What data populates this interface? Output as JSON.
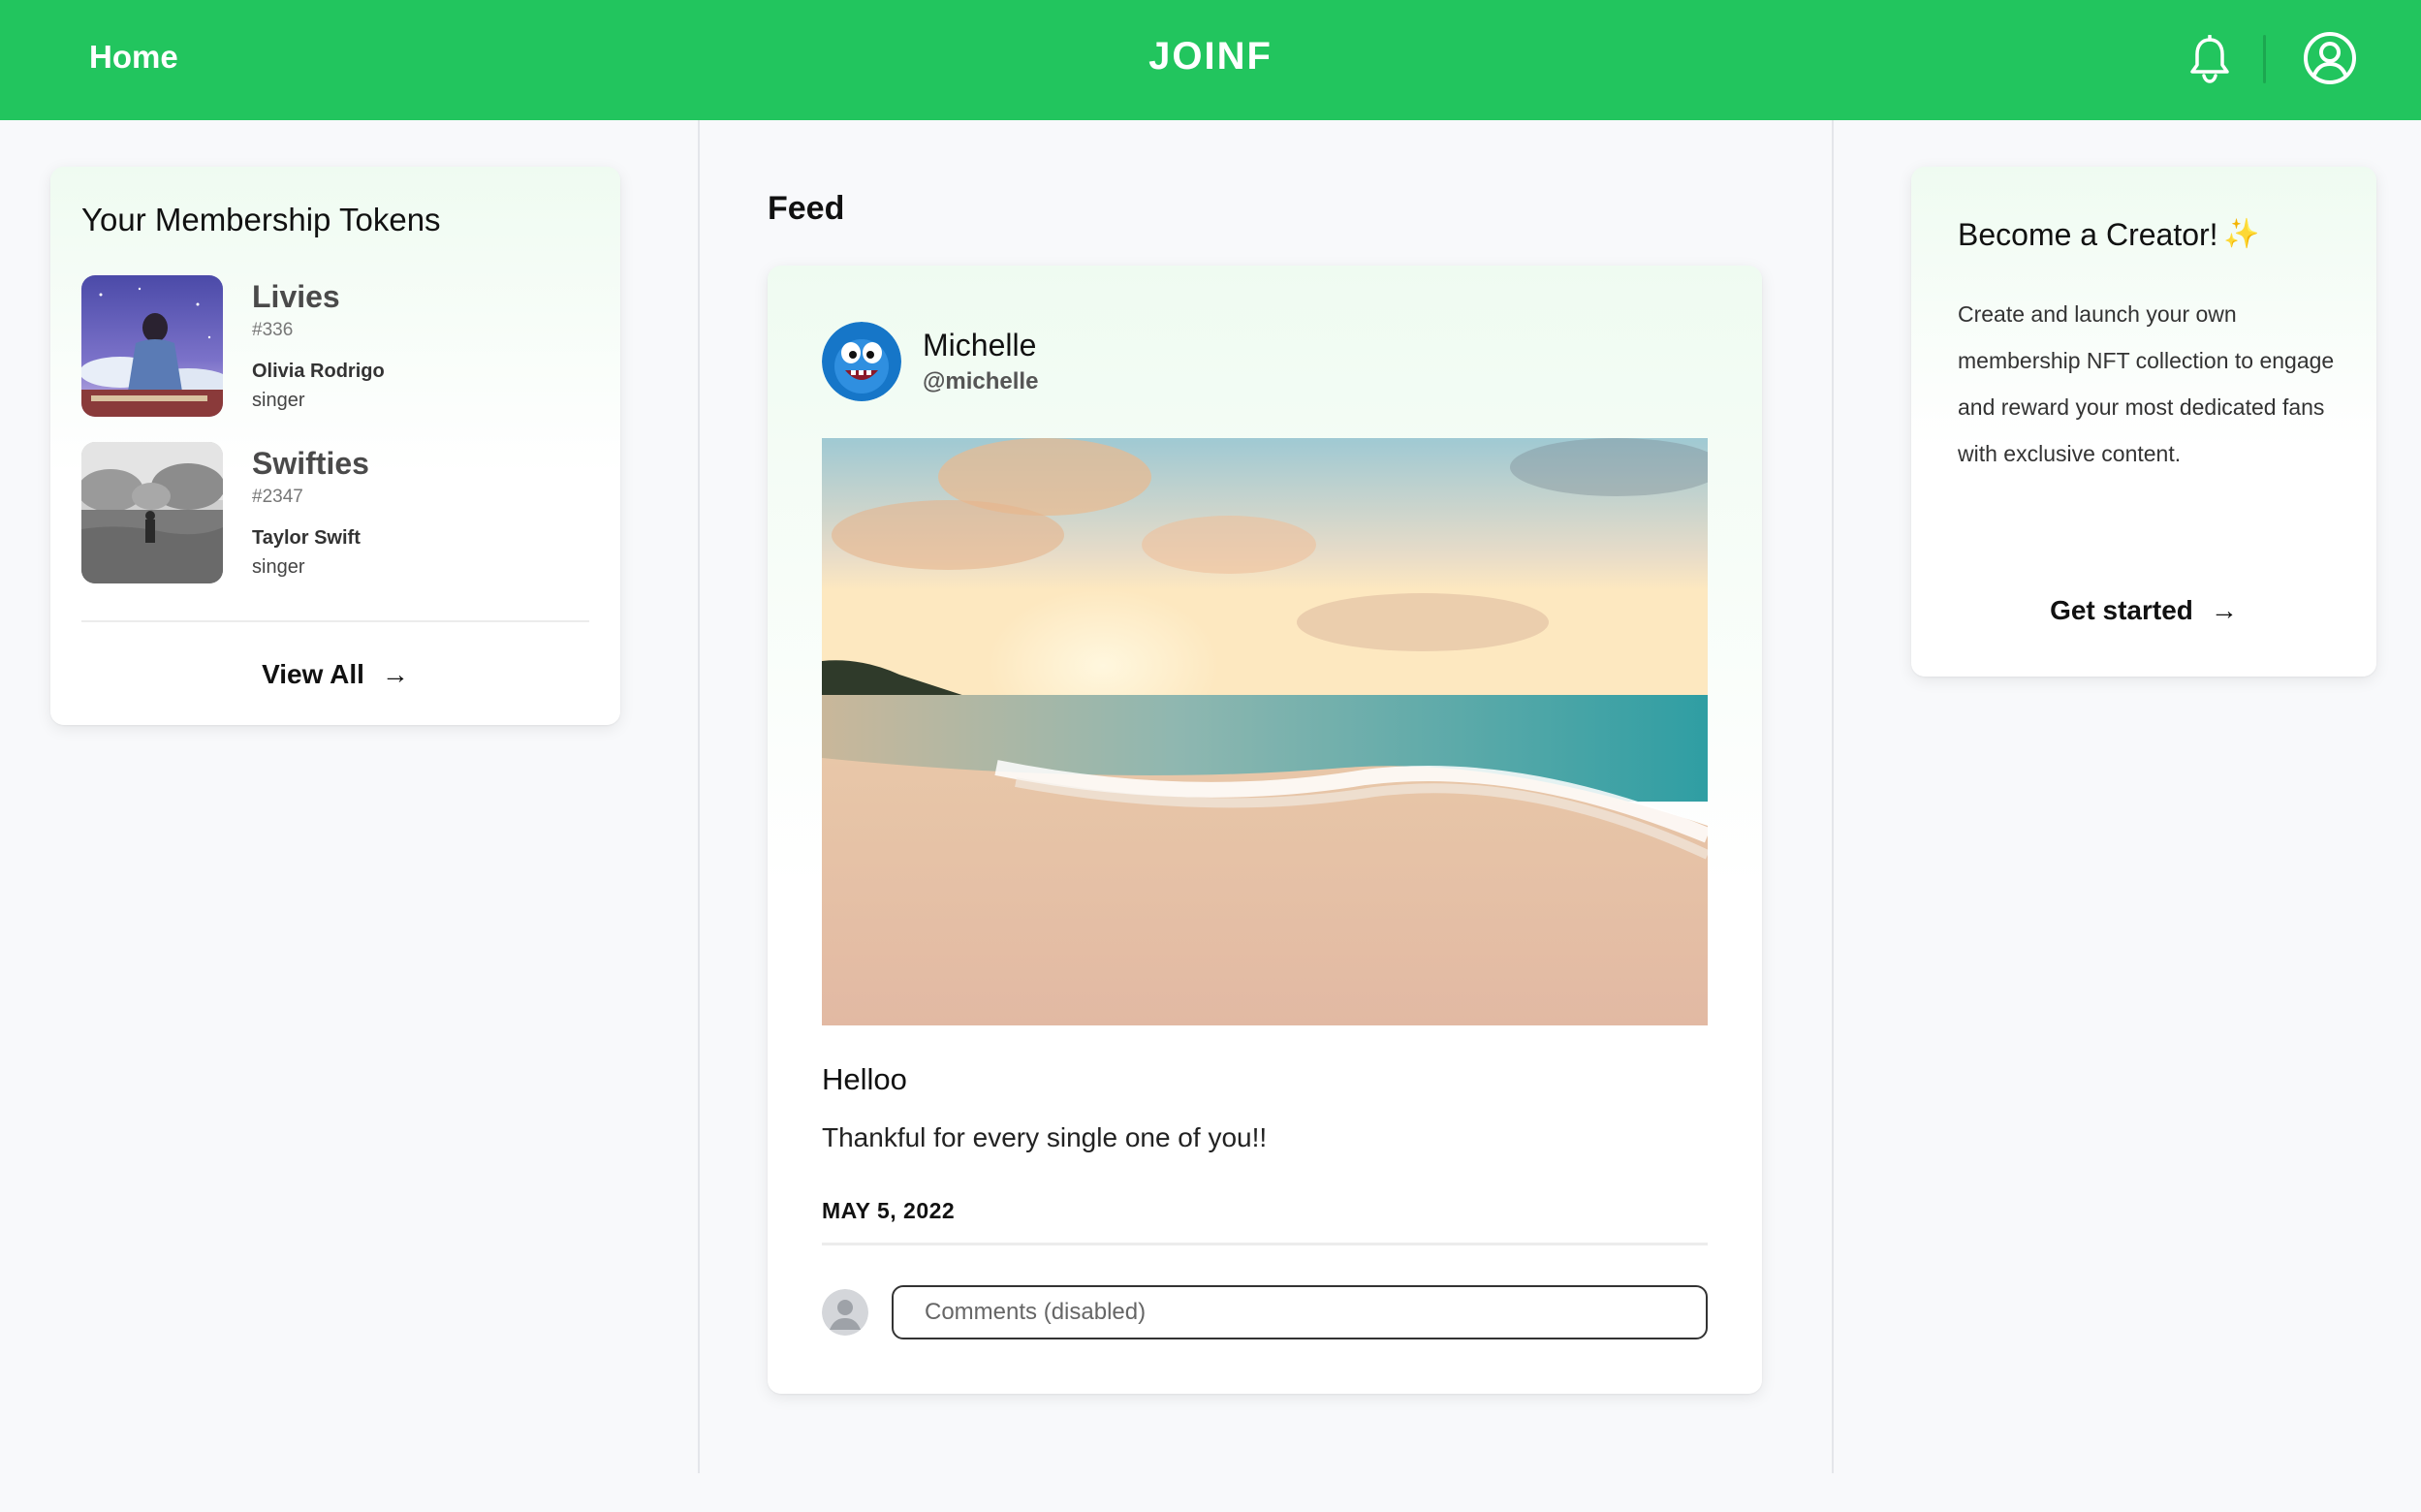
{
  "header": {
    "home_label": "Home",
    "brand": "JOINF",
    "bell_icon": "bell-icon",
    "user_icon": "user-circle-icon",
    "accent_color": "#22c55e"
  },
  "tokens": {
    "title": "Your Membership Tokens",
    "items": [
      {
        "name": "Livies",
        "number": "#336",
        "artist": "Olivia Rodrigo",
        "role": "singer"
      },
      {
        "name": "Swifties",
        "number": "#2347",
        "artist": "Taylor Swift",
        "role": "singer"
      }
    ],
    "view_all_label": "View All",
    "arrow_icon": "arrow-right-icon"
  },
  "feed": {
    "title": "Feed",
    "post": {
      "author": "Michelle",
      "handle": "@michelle",
      "title": "Helloo",
      "body": "Thankful for every single one of you!!",
      "date": "MAY 5, 2022",
      "comment_placeholder": "Comments (disabled)"
    }
  },
  "creator": {
    "title": "Become a Creator!",
    "sparkle": "✨",
    "body": "Create and launch your own membership NFT collection to engage and reward your most dedicated fans with exclusive content.",
    "cta_label": "Get started",
    "arrow_icon": "arrow-right-icon"
  }
}
